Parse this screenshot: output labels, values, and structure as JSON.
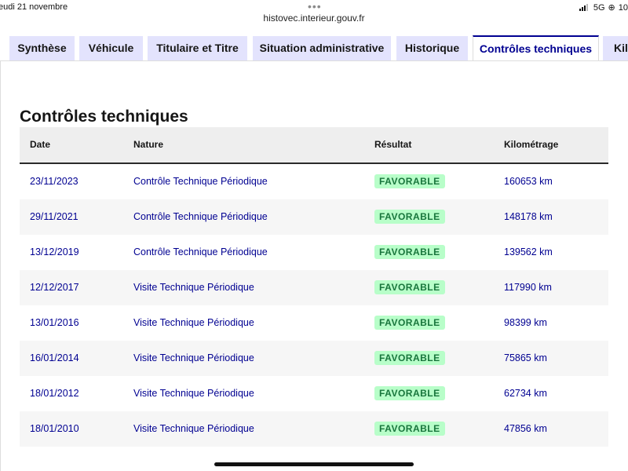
{
  "status_bar": {
    "date": "eudi 21 novembre",
    "network": "5G",
    "battery": "10",
    "url": "histovec.interieur.gouv.fr"
  },
  "tabs": [
    {
      "label": "Synthèse",
      "active": false
    },
    {
      "label": "Véhicule",
      "active": false
    },
    {
      "label": "Titulaire et Titre",
      "active": false
    },
    {
      "label": "Situation administrative",
      "active": false
    },
    {
      "label": "Historique",
      "active": false
    },
    {
      "label": "Contrôles techniques",
      "active": true
    },
    {
      "label": "Kilo",
      "active": false
    }
  ],
  "section": {
    "title": "Contrôles techniques"
  },
  "table": {
    "headers": {
      "date": "Date",
      "nature": "Nature",
      "result": "Résultat",
      "mileage": "Kilométrage"
    },
    "rows": [
      {
        "date": "23/11/2023",
        "nature": "Contrôle Technique Périodique",
        "result": "FAVORABLE",
        "mileage": "160653 km"
      },
      {
        "date": "29/11/2021",
        "nature": "Contrôle Technique Périodique",
        "result": "FAVORABLE",
        "mileage": "148178 km"
      },
      {
        "date": "13/12/2019",
        "nature": "Contrôle Technique Périodique",
        "result": "FAVORABLE",
        "mileage": "139562 km"
      },
      {
        "date": "12/12/2017",
        "nature": "Visite Technique Périodique",
        "result": "FAVORABLE",
        "mileage": "117990 km"
      },
      {
        "date": "13/01/2016",
        "nature": "Visite Technique Périodique",
        "result": "FAVORABLE",
        "mileage": "98399 km"
      },
      {
        "date": "16/01/2014",
        "nature": "Visite Technique Périodique",
        "result": "FAVORABLE",
        "mileage": "75865 km"
      },
      {
        "date": "18/01/2012",
        "nature": "Visite Technique Périodique",
        "result": "FAVORABLE",
        "mileage": "62734 km"
      },
      {
        "date": "18/01/2010",
        "nature": "Visite Technique Périodique",
        "result": "FAVORABLE",
        "mileage": "47856 km"
      }
    ]
  },
  "colors": {
    "accent": "#000091",
    "tab_bg": "#e3e3fd",
    "badge_bg": "#b8fec9",
    "badge_text": "#18753c"
  }
}
